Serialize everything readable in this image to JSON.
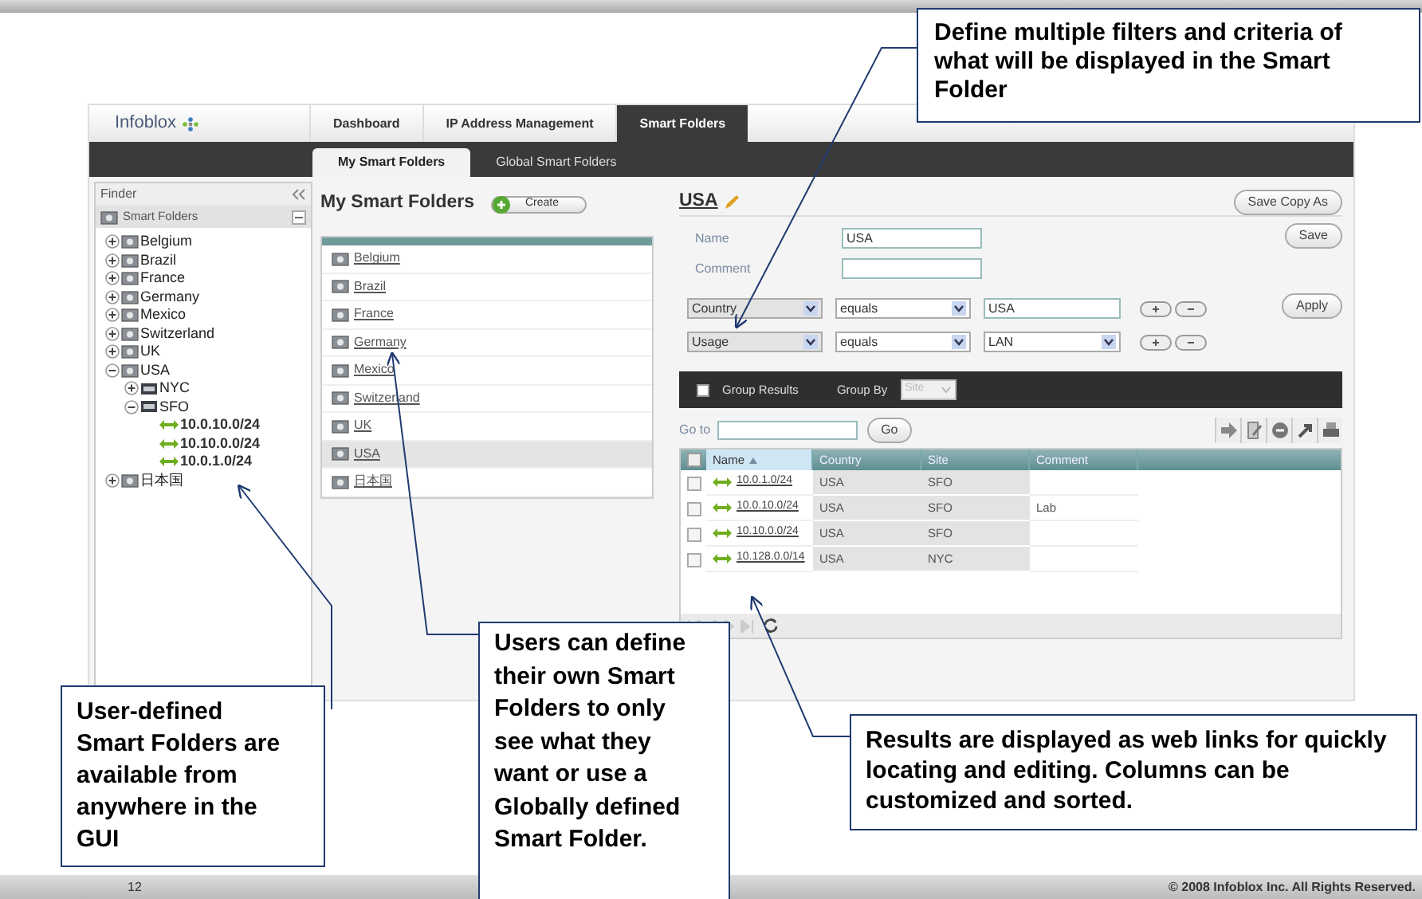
{
  "app": {
    "logo": "Infoblox",
    "nav_tabs": [
      {
        "label": "Dashboard",
        "selected": false
      },
      {
        "label": "IP Address Management",
        "selected": false
      },
      {
        "label": "Smart Folders",
        "selected": true
      }
    ],
    "sub_tabs": [
      {
        "label": "My Smart Folders",
        "selected": true
      },
      {
        "label": "Global Smart Folders",
        "selected": false
      }
    ],
    "finder": {
      "title": "Finder",
      "root": "Smart Folders",
      "tree": [
        {
          "label": "Belgium",
          "kind": "folder",
          "expanded": false
        },
        {
          "label": "Brazil",
          "kind": "folder",
          "expanded": false
        },
        {
          "label": "France",
          "kind": "folder",
          "expanded": false
        },
        {
          "label": "Germany",
          "kind": "folder",
          "expanded": false
        },
        {
          "label": "Mexico",
          "kind": "folder",
          "expanded": false
        },
        {
          "label": "Switzerland",
          "kind": "folder",
          "expanded": false
        },
        {
          "label": "UK",
          "kind": "folder",
          "expanded": false
        },
        {
          "label": "USA",
          "kind": "folder",
          "expanded": true,
          "children": [
            {
              "label": "NYC",
              "kind": "site",
              "expanded": false
            },
            {
              "label": "SFO",
              "kind": "site",
              "expanded": true,
              "children": [
                {
                  "label": "10.0.10.0/24",
                  "kind": "network"
                },
                {
                  "label": "10.10.0.0/24",
                  "kind": "network"
                },
                {
                  "label": "10.0.1.0/24",
                  "kind": "network"
                }
              ]
            }
          ]
        },
        {
          "label": "日本国",
          "kind": "folder",
          "expanded": false
        }
      ]
    },
    "folders": {
      "title": "My Smart Folders",
      "create": "Create",
      "items": [
        {
          "label": "Belgium",
          "selected": false
        },
        {
          "label": "Brazil",
          "selected": false
        },
        {
          "label": "France",
          "selected": false
        },
        {
          "label": "Germany",
          "selected": false
        },
        {
          "label": "Mexico",
          "selected": false
        },
        {
          "label": "Switzerland",
          "selected": false
        },
        {
          "label": "UK",
          "selected": false
        },
        {
          "label": "USA",
          "selected": true
        },
        {
          "label": "日本国",
          "selected": false
        }
      ]
    },
    "detail": {
      "title": "USA",
      "save_copy": "Save Copy As",
      "save": "Save",
      "apply": "Apply",
      "name_label": "Name",
      "name_value": "USA",
      "comment_label": "Comment",
      "filters": [
        {
          "field": "Country",
          "operator": "equals",
          "value": "USA",
          "kind": "text"
        },
        {
          "field": "Usage",
          "operator": "equals",
          "value": "LAN",
          "kind": "select"
        }
      ],
      "group_results": {
        "label": "Group Results",
        "checked": false
      },
      "group_by": {
        "label": "Group By",
        "value": "Site",
        "disabled": true
      },
      "goto_label": "Go to",
      "go": "Go",
      "table": {
        "select_all_checked": false,
        "columns": [
          {
            "label": "Name",
            "sorted": true
          },
          {
            "label": "Country",
            "sorted": false
          },
          {
            "label": "Site",
            "sorted": false
          },
          {
            "label": "Comment",
            "sorted": false
          }
        ],
        "rows": [
          {
            "name": "10.0.1.0/24",
            "country": "USA",
            "site": "SFO",
            "comment": "",
            "checked": false
          },
          {
            "name": "10.0.10.0/24",
            "country": "USA",
            "site": "SFO",
            "comment": "Lab",
            "checked": false
          },
          {
            "name": "10.10.0.0/24",
            "country": "USA",
            "site": "SFO",
            "comment": "",
            "checked": false
          },
          {
            "name": "10.128.0.0/14",
            "country": "USA",
            "site": "NYC",
            "comment": "",
            "checked": false
          }
        ]
      }
    }
  },
  "callouts": [
    {
      "text": "Define multiple filters and criteria of what will be displayed in the Smart Folder"
    },
    {
      "text": "User-defined Smart Folders are available from anywhere in the GUI"
    },
    {
      "text": "Users can define their own Smart Folders to only see what they want or use a Globally defined Smart Folder."
    },
    {
      "text": "Results are displayed as web links for quickly locating and editing. Columns can be customized and sorted."
    }
  ],
  "footer": {
    "page": "12",
    "copyright": "© 2008 Infoblox Inc. All Rights Reserved."
  }
}
